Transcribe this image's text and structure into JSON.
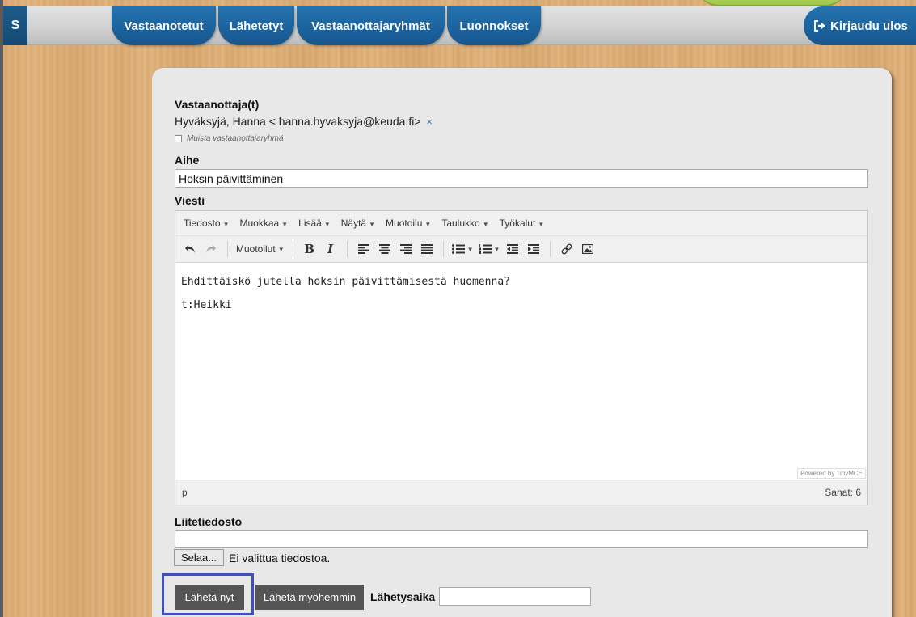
{
  "nav": {
    "brand": "S",
    "tabs": [
      {
        "label": "Vastaanotetut"
      },
      {
        "label": "Lähetetyt"
      },
      {
        "label": "Vastaanottajaryhmät"
      },
      {
        "label": "Luonnokset"
      }
    ],
    "logout_label": "Kirjaudu ulos",
    "logout_icon": "sign-out-icon"
  },
  "form": {
    "recipients_label": "Vastaanottaja(t)",
    "recipient": "Hyväksyjä, Hanna < hanna.hyvaksyja@keuda.fi>",
    "remove_symbol": "×",
    "remember_group_label": "Muista vastaanottajaryhmä",
    "subject_label": "Aihe",
    "subject_value": "Hoksin päivittäminen",
    "message_label": "Viesti",
    "attachment_label": "Liitetiedosto",
    "browse_label": "Selaa...",
    "no_file_text": "Ei valittua tiedostoa.",
    "send_now": "Lähetä nyt",
    "send_later": "Lähetä myöhemmin",
    "send_time_label": "Lähetysaika",
    "send_time_value": ""
  },
  "editor": {
    "menus": [
      "Tiedosto",
      "Muokkaa",
      "Lisää",
      "Näytä",
      "Muotoilu",
      "Taulukko",
      "Työkalut"
    ],
    "formats_label": "Muotoilut",
    "content": [
      "Ehdittäiskö jutella hoksin päivittämisestä huomenna?",
      "t:Heikki"
    ],
    "powered_by": "Powered by TinyMCE",
    "path": "p",
    "word_count": "Sanat: 6"
  },
  "colors": {
    "nav_blue": "#1c66a0",
    "highlight": "#3f4fc7",
    "button_dark": "#555555"
  }
}
